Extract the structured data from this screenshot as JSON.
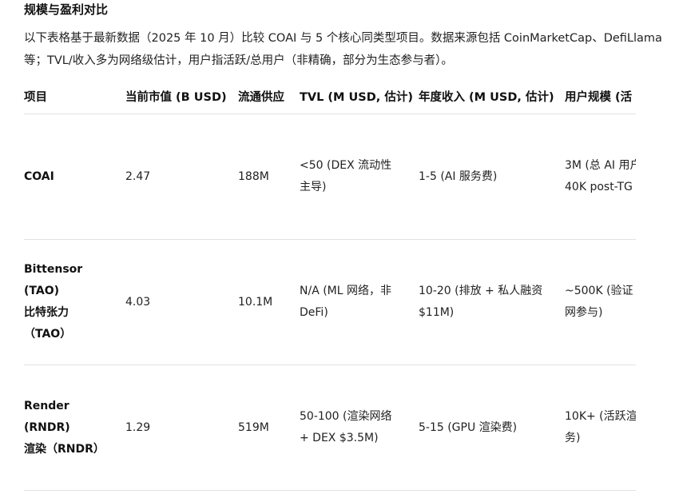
{
  "heading": "规模与盈利对比",
  "intro": "以下表格基于最新数据（2025 年 10 月）比较 COAI 与 5 个核心同类型项目。数据来源包括 CoinMarketCap、DefiLlama 等；TVL/收入多为网络级估计，用户指活跃/总用户（非精确，部分为生态参与者）。",
  "table": {
    "headers": [
      "项目",
      "当前市值 (B USD)",
      "流通供应",
      "TVL (M USD, 估计)",
      "年度收入 (M USD, 估计)",
      "用户规模 (活"
    ],
    "rows": [
      {
        "name": [
          "COAI"
        ],
        "market_cap": "2.47",
        "supply": "188M",
        "tvl": [
          "<50 (DEX 流动性",
          "主导)"
        ],
        "revenue": [
          "1-5 (AI 服务费)"
        ],
        "users": [
          "3M (总 AI 用户",
          "40K post-TG"
        ]
      },
      {
        "name": [
          "Bittensor",
          "(TAO)",
          "比特张力",
          "（TAO）"
        ],
        "market_cap": "4.03",
        "supply": "10.1M",
        "tvl": [
          "N/A (ML 网络，非",
          "DeFi)"
        ],
        "revenue": [
          "10-20 (排放 + 私人融资",
          "$11M)"
        ],
        "users": [
          "~500K (验证",
          "网参与)"
        ]
      },
      {
        "name": [
          "Render",
          "(RNDR)",
          "渲染（RNDR）"
        ],
        "market_cap": "1.29",
        "supply": "519M",
        "tvl": [
          "50-100 (渲染网络",
          "+ DEX $3.5M)"
        ],
        "revenue": [
          "5-15 (GPU 渲染费)"
        ],
        "users": [
          "10K+ (活跃渲",
          "务)"
        ]
      }
    ]
  }
}
